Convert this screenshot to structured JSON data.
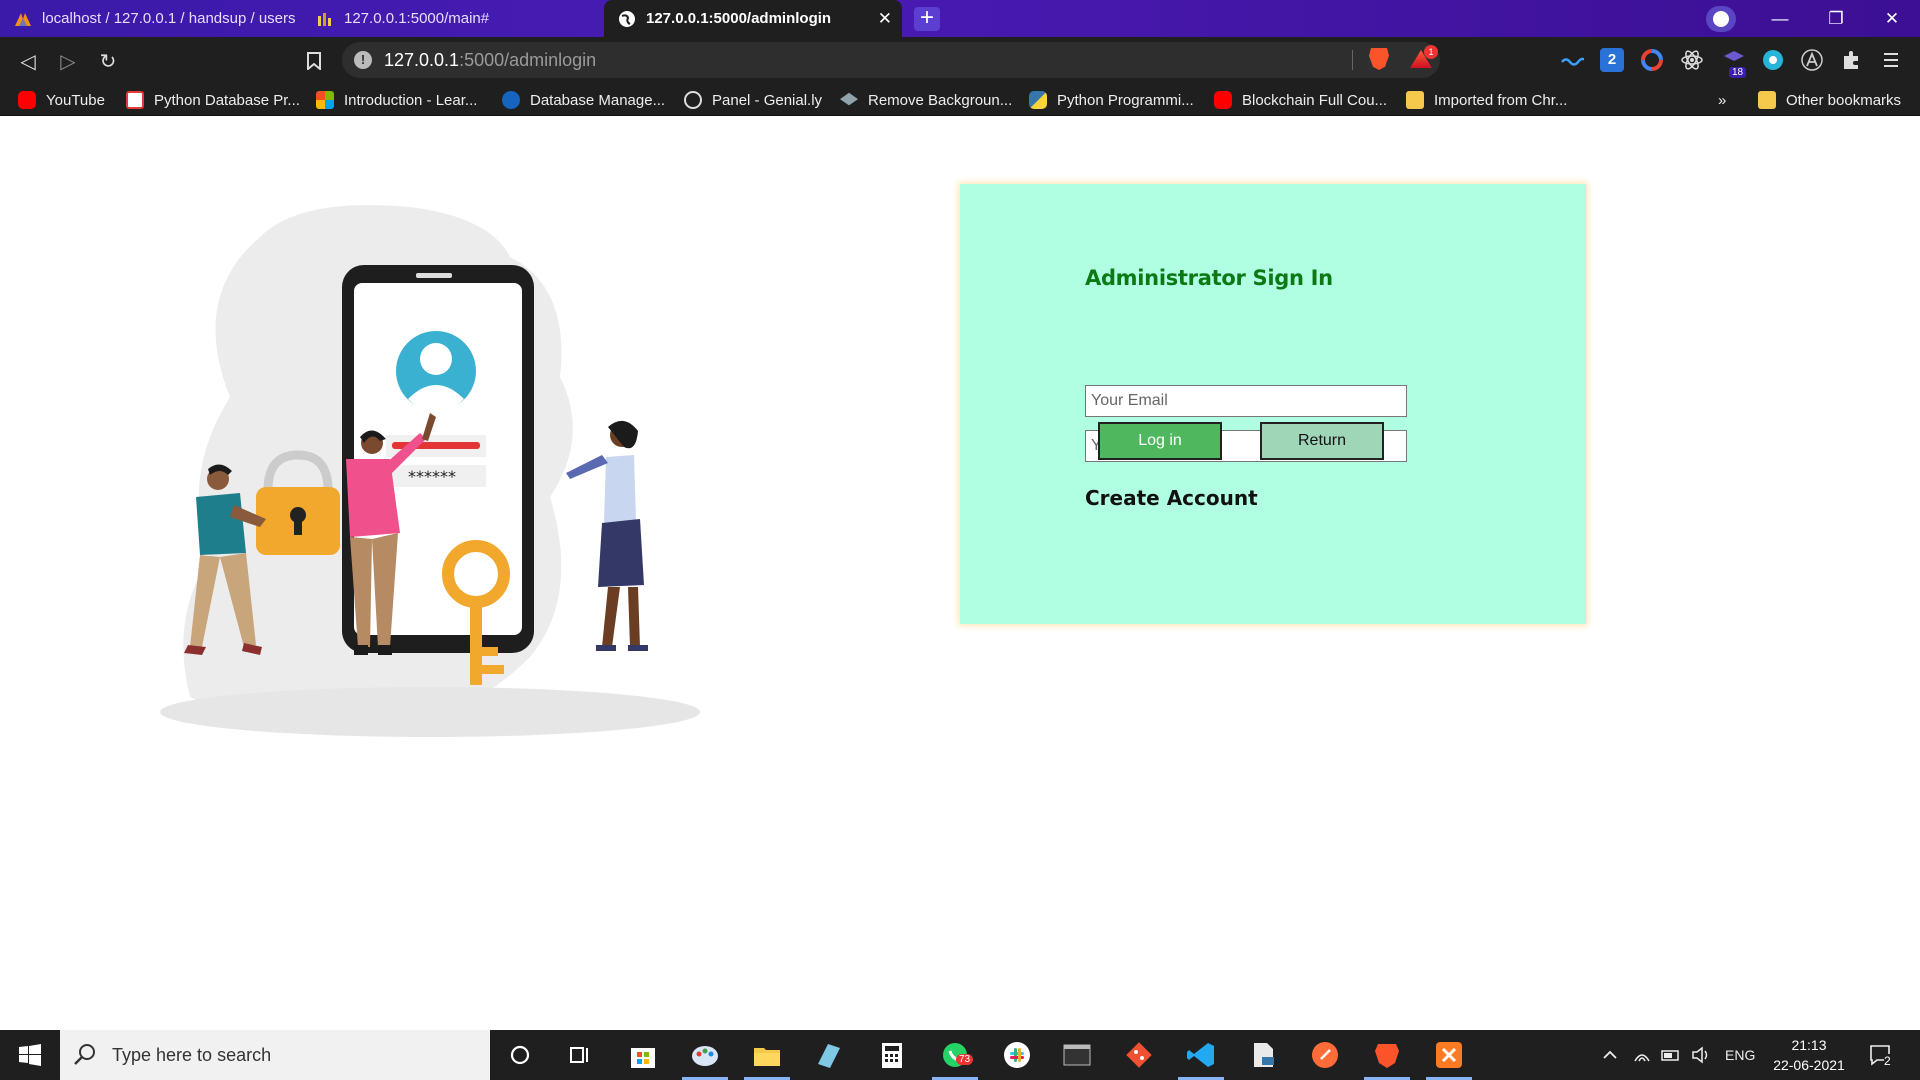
{
  "browser": {
    "tabs": [
      {
        "label": "localhost / 127.0.0.1 / handsup / users",
        "active": false
      },
      {
        "label": "127.0.0.1:5000/main#",
        "active": false
      },
      {
        "label": "127.0.0.1:5000/adminlogin",
        "active": true
      }
    ],
    "close_glyph": "✕",
    "new_tab_glyph": "+",
    "window_controls": {
      "minimize": "—",
      "restore": "❐",
      "close": "✕"
    },
    "url_host": "127.0.0.1",
    "url_rest": ":5000/adminlogin",
    "rewards_badge": "1",
    "ext_badge_2": "2",
    "ext_badge_18": "18",
    "bookmarks": [
      {
        "label": "YouTube",
        "color": "#ff0000"
      },
      {
        "label": "Python Database Pr...",
        "color": "#e53935"
      },
      {
        "label": "Introduction - Lear...",
        "color": "#f25022"
      },
      {
        "label": "Database Manage...",
        "color": "#1565c0"
      },
      {
        "label": "Panel - Genial.ly",
        "color": "#9e9e9e"
      },
      {
        "label": "Remove Backgroun...",
        "color": "#90a4ae"
      },
      {
        "label": "Python Programmi...",
        "color": "#3776ab"
      },
      {
        "label": "Blockchain Full Cou...",
        "color": "#ff0000"
      },
      {
        "label": "Imported from Chr...",
        "color": "#f6c84c"
      }
    ],
    "overflow": "»",
    "other_bookmarks": "Other bookmarks"
  },
  "login": {
    "title": "Administrator Sign In",
    "email_placeholder": "Your Email",
    "password_placeholder": "Your Password",
    "login_label": "Log in",
    "return_label": "Return",
    "create_account": "Create Account",
    "panel_color": "#b0ffe3",
    "title_color": "#0b7a14"
  },
  "taskbar": {
    "search_placeholder": "Type here to search",
    "whatsapp_badge": "73",
    "language": "ENG",
    "time": "21:13",
    "date": "22-06-2021",
    "notifications": "2"
  }
}
